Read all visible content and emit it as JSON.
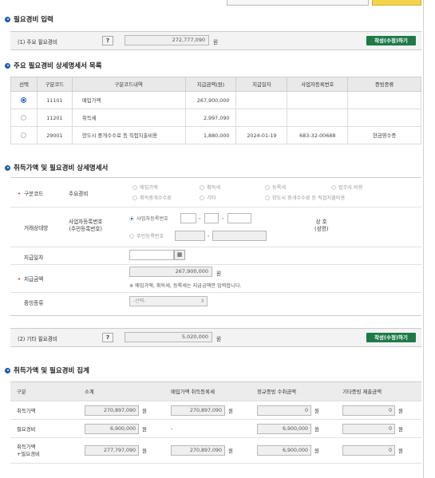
{
  "top": {
    "partial_text": "···"
  },
  "section1": {
    "title": "필요경비 입력"
  },
  "main_expense": {
    "label": "(1) 주요 필요경비",
    "help": "?",
    "value": "272,777,090",
    "unit": "원",
    "button": "작성(수정)하기"
  },
  "section2": {
    "title": "주요 필요경비 상세명세서 목록"
  },
  "list": {
    "headers": [
      "선택",
      "구분코드",
      "구분코드내역",
      "지급금액(원)",
      "지급일자",
      "사업자등록번호",
      "증빙종류"
    ],
    "rows": [
      {
        "code": "11101",
        "desc": "매입가액",
        "amount": "267,900,000",
        "date": "",
        "bizno": "",
        "proof": "",
        "selected": true
      },
      {
        "code": "11201",
        "desc": "취득세",
        "amount": "2,997,090",
        "date": "",
        "bizno": "",
        "proof": "",
        "selected": false
      },
      {
        "code": "29001",
        "desc": "양도시 중개수수료 등 직접지출비용",
        "amount": "1,880,000",
        "date": "2024-01-19",
        "bizno": "683-32-00688",
        "proof": "현금영수증",
        "selected": false
      }
    ]
  },
  "section3": {
    "title": "취득가액 및 필요경비 상세명세서"
  },
  "form": {
    "category_label": "구분코드",
    "category_sub": "주요경비",
    "options": [
      "매입가액",
      "취득세",
      "등록세",
      "법무사 비용",
      "취득중개수수료",
      "기타",
      "양도시 중개수수료 등 직접지출비용"
    ],
    "party_label": "거래상대방",
    "bizno_label": "사업자등록번호\n(주민등록번호)",
    "bizno_option": "사업자등록번호",
    "resno_option": "주민등록번호",
    "company_label": "상 호\n(성명)",
    "date_label": "지급일자",
    "calendar_icon": "▦",
    "amount_label": "지급금액",
    "amount_value": "267,900,000",
    "amount_unit": "원",
    "amount_note": "※ 매입가액, 취득세, 등록세는 지급금액만 입력합니다.",
    "proof_label": "증빙종류",
    "proof_select": "-선택-"
  },
  "other_expense": {
    "label": "(2) 기타 필요경비",
    "help": "?",
    "value": "5,020,000",
    "unit": "원",
    "button": "작성(수정)하기"
  },
  "section4": {
    "title": "취득가액 및 필요경비 집계"
  },
  "summary": {
    "headers": [
      "구분",
      "소계",
      "매입가액 취득등록세",
      "정규증빙 수취금액",
      "기타증빙 제출금액"
    ],
    "rows": [
      {
        "label": "취득가액",
        "subtotal": "270,897,090",
        "purchase": "270,897,090",
        "regular": "0",
        "other": "0"
      },
      {
        "label": "필요경비",
        "subtotal": "6,900,000",
        "purchase": "-",
        "regular": "6,900,000",
        "other": "0"
      },
      {
        "label": "취득가액\n+필요경비",
        "subtotal": "277,797,090",
        "purchase": "270,897,090",
        "regular": "6,900,000",
        "other": "0"
      }
    ],
    "unit": "원"
  }
}
